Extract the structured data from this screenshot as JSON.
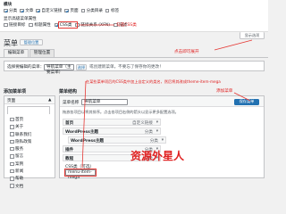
{
  "screen_options": {
    "group1_title": "模块",
    "row1": [
      "分类",
      "文章",
      "自定义链接",
      "页面",
      "分类目录",
      "标签"
    ],
    "row1_checked": [
      true,
      true,
      true,
      true,
      false,
      false
    ],
    "group2_title": "显示高级菜单属性",
    "row2": [
      "链接目标",
      "标题属性",
      "CSS类",
      "链接关系 (XFN)",
      "描述"
    ],
    "row2_checked": [
      false,
      false,
      true,
      false,
      false
    ],
    "tab_button": "显示选项"
  },
  "annotations": {
    "check_css": "勾选CSS类",
    "click_expand": "点击即可展开",
    "note_line": "在某些菜单项后的CSS类中加上自定义的类名，然后将其改成theme-item-mega",
    "add_menu": "添加菜单",
    "watermark": "资源外星人"
  },
  "page": {
    "title": "菜单",
    "manage_button": "管理位置",
    "tabs": [
      "编辑菜单",
      "管理位置"
    ],
    "select_label": "选择要编辑的菜单：",
    "select_value": "导航菜单（主要菜单）",
    "select_button": "选择",
    "create_hint": "或创建新菜单。不要忘了保存你的更改！"
  },
  "left_panel": {
    "title": "添加菜单项",
    "section": "页面",
    "items": [
      "首页",
      "关于",
      "联系我们",
      "隐私政策",
      "服务",
      "留言",
      "案例",
      "新闻",
      "帮助",
      "文档"
    ]
  },
  "right_panel": {
    "title": "菜单结构",
    "name_label": "菜单名称",
    "name_value": "导航菜单",
    "save_button": "保存菜单",
    "hint": "拖放各项目以将其排序。点击各项目右侧的箭头以显示更多配置选项。",
    "items": [
      {
        "title": "首页",
        "type": "自定义链接"
      },
      {
        "title": "WordPress主题",
        "type": "分类"
      },
      {
        "title": "WordPress主题",
        "type": "分类"
      },
      {
        "title": "插件",
        "type": "分类"
      },
      {
        "title": "教程",
        "type": "分类"
      }
    ],
    "css_label": "CSS类（可选）",
    "css_value": "menu-item-mega"
  }
}
